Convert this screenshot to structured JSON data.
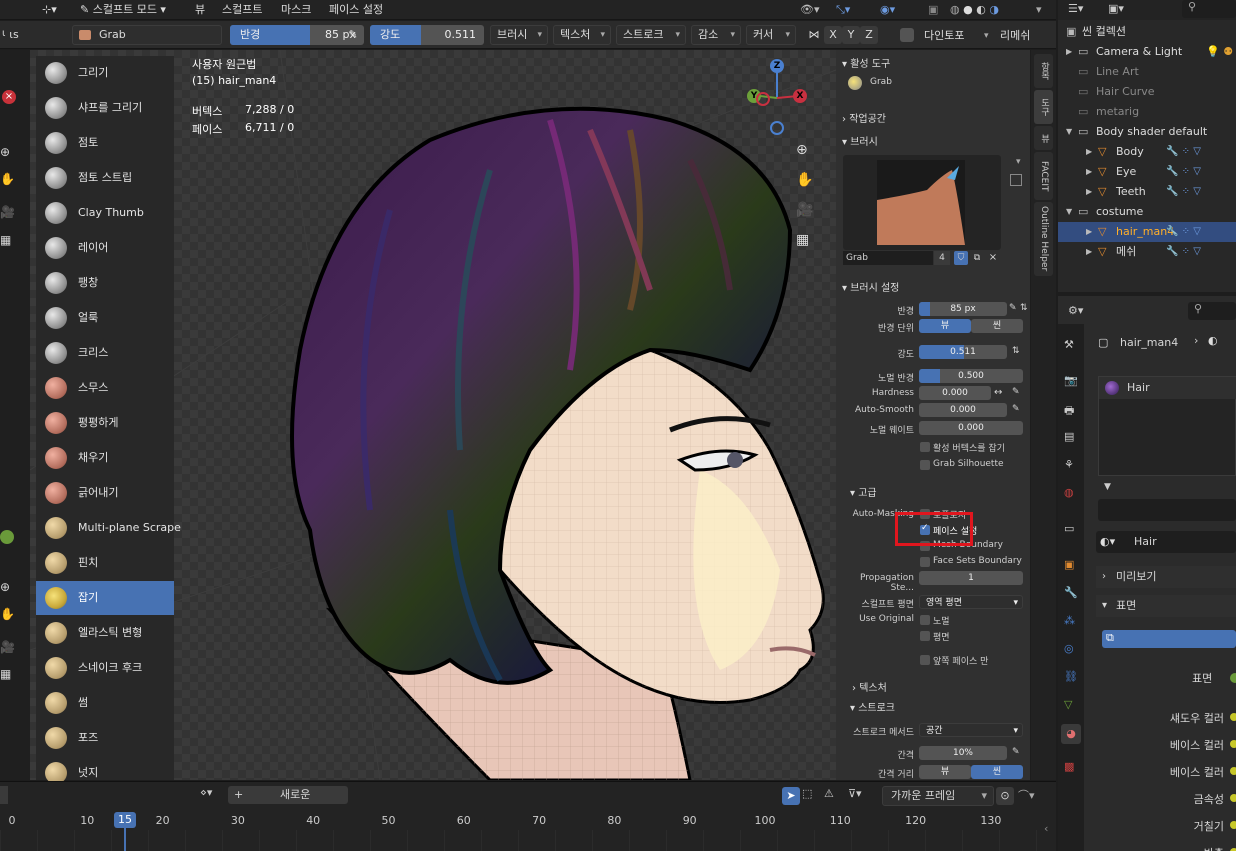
{
  "top_menu": {
    "mode": "스컬프트 모드",
    "items": [
      "뷰",
      "스컬프트",
      "마스크",
      "페이스 설정"
    ]
  },
  "tool_header": {
    "brush_name": "Grab",
    "radius_label": "반경",
    "radius_value": "85 px",
    "radius_fill": 0.6,
    "strength_label": "강도",
    "strength_value": "0.511",
    "strength_fill": 0.45,
    "dropdowns": [
      "브러시",
      "텍스처",
      "스트로크",
      "감소",
      "커서"
    ],
    "axes": [
      "X",
      "Y",
      "Z"
    ],
    "topology": "다인토포",
    "remesh": "리메쉬"
  },
  "tools": [
    {
      "label": "그리기",
      "icon": "draw-brush-icon",
      "style": ""
    },
    {
      "label": "샤프를 그리기",
      "icon": "draw-sharp-brush-icon",
      "style": ""
    },
    {
      "label": "점토",
      "icon": "clay-brush-icon",
      "style": ""
    },
    {
      "label": "점토 스트립",
      "icon": "clay-strips-brush-icon",
      "style": ""
    },
    {
      "label": "Clay Thumb",
      "icon": "clay-thumb-brush-icon",
      "style": ""
    },
    {
      "label": "레이어",
      "icon": "layer-brush-icon",
      "style": ""
    },
    {
      "label": "팽창",
      "icon": "inflate-brush-icon",
      "style": ""
    },
    {
      "label": "얼룩",
      "icon": "blob-brush-icon",
      "style": ""
    },
    {
      "label": "크리스",
      "icon": "crease-brush-icon",
      "style": ""
    },
    {
      "label": "스무스",
      "icon": "smooth-brush-icon",
      "style": "red"
    },
    {
      "label": "평평하게",
      "icon": "flatten-brush-icon",
      "style": "red"
    },
    {
      "label": "채우기",
      "icon": "fill-brush-icon",
      "style": "red"
    },
    {
      "label": "긁어내기",
      "icon": "scrape-brush-icon",
      "style": "red"
    },
    {
      "label": "Multi-plane Scrape",
      "icon": "multiplane-scrape-brush-icon",
      "style": "warm"
    },
    {
      "label": "핀치",
      "icon": "pinch-brush-icon",
      "style": "warm"
    },
    {
      "label": "잡기",
      "icon": "grab-brush-icon",
      "style": "active",
      "active": true
    },
    {
      "label": "엘라스틱 변형",
      "icon": "elastic-deform-brush-icon",
      "style": "warm"
    },
    {
      "label": "스네이크 후크",
      "icon": "snake-hook-brush-icon",
      "style": "warm"
    },
    {
      "label": "썸",
      "icon": "thumb-brush-icon",
      "style": "warm"
    },
    {
      "label": "포즈",
      "icon": "pose-brush-icon",
      "style": "warm"
    },
    {
      "label": "넛지",
      "icon": "nudge-brush-icon",
      "style": "warm"
    }
  ],
  "viewport": {
    "view_name": "사용자 원근법",
    "object_name": "(15) hair_man4",
    "vertices_label": "버텍스",
    "vertices_value": "7,288 / 0",
    "faces_label": "페이스",
    "faces_value": "6,711 / 0",
    "gizmo_axes": [
      "X",
      "Y",
      "Z"
    ]
  },
  "npanel": {
    "active_tool_header": "활성 도구",
    "active_tool_name": "Grab",
    "workspace_header": "작업공간",
    "brush_header": "브러시",
    "brush_name": "Grab",
    "brush_users": "4",
    "brush_settings_header": "브러시 설정",
    "radius_label": "반경",
    "radius_value": "85 px",
    "radius_unit_label": "반경 단위",
    "radius_unit_options": [
      "뷰",
      "씬"
    ],
    "strength_label": "강도",
    "strength_value": "0.511",
    "strength_fill": 0.511,
    "normal_radius_label": "노멀 반경",
    "normal_radius_value": "0.500",
    "normal_radius_fill": 0.2,
    "hardness_label": "Hardness",
    "hardness_value": "0.000",
    "auto_smooth_label": "Auto-Smooth",
    "auto_smooth_value": "0.000",
    "normal_weight_label": "노멀 웨이트",
    "normal_weight_value": "0.000",
    "grab_active_vertex": "활성 버텍스를 잡기",
    "grab_silhouette": "Grab Silhouette",
    "advanced_header": "고급",
    "auto_masking_label": "Auto-Masking",
    "topology_option": "토폴로지",
    "face_sets_option": "페이스 설정",
    "mesh_boundary_option": "Mesh Boundary",
    "face_sets_boundary_option": "Face Sets Boundary",
    "propagation_label": "Propagation Ste...",
    "propagation_value": "1",
    "sculpt_plane_label": "스컬프트 평면",
    "sculpt_plane_value": "영역 평면",
    "use_original_label": "Use Original",
    "use_original_normal": "노멀",
    "use_original_plane": "평면",
    "front_faces_only": "앞쪽 페이스 만",
    "texture_header": "텍스처",
    "stroke_header": "스트로크",
    "stroke_method_label": "스트로크 메서드",
    "stroke_method_value": "공간",
    "spacing_label": "간격",
    "spacing_value": "10%",
    "spacing_distance_label": "간격 거리",
    "spacing_distance_options": [
      "뷰",
      "씬"
    ],
    "highlight_color": "#e0161e"
  },
  "vertical_tabs": [
    "항목",
    "도구",
    "뷰",
    "FACEIT",
    "Outline Helper"
  ],
  "outliner": {
    "header": "씬 컬렉션",
    "rows": [
      {
        "label": "Camera & Light",
        "indent": 1,
        "expand": "▶",
        "kind": "collection"
      },
      {
        "label": "Line Art",
        "indent": 1,
        "expand": "",
        "kind": "collection-dim"
      },
      {
        "label": "Hair Curve",
        "indent": 1,
        "expand": "",
        "kind": "collection-dim"
      },
      {
        "label": "metarig",
        "indent": 1,
        "expand": "",
        "kind": "collection-dim"
      },
      {
        "label": "Body shader default",
        "indent": 1,
        "expand": "▼",
        "kind": "collection"
      },
      {
        "label": "Body",
        "indent": 2,
        "expand": "▶",
        "kind": "mesh"
      },
      {
        "label": "Eye",
        "indent": 2,
        "expand": "▶",
        "kind": "mesh"
      },
      {
        "label": "Teeth",
        "indent": 2,
        "expand": "▶",
        "kind": "mesh"
      },
      {
        "label": "costume",
        "indent": 1,
        "expand": "▼",
        "kind": "collection"
      },
      {
        "label": "hair_man4",
        "indent": 2,
        "expand": "▶",
        "kind": "mesh-selected",
        "selected": true
      },
      {
        "label": "메쉬",
        "indent": 2,
        "expand": "▶",
        "kind": "mesh"
      }
    ]
  },
  "properties": {
    "object_name": "hair_man4",
    "material_slot": "Hair",
    "material_name": "Hair",
    "preview_header": "미리보기",
    "surface_header": "표면",
    "surface_label": "표면",
    "rows": [
      "섀도우 컬러",
      "베이스 컬러",
      "베이스 컬러",
      "금속성",
      "거칠기",
      "반출"
    ]
  },
  "timeline": {
    "new_label": "새로운",
    "snap_label": "가까운 프레임",
    "current_frame": "15",
    "frames": [
      "0",
      "10",
      "20",
      "30",
      "40",
      "50",
      "60",
      "70",
      "80",
      "90",
      "100",
      "110",
      "120",
      "130"
    ]
  }
}
